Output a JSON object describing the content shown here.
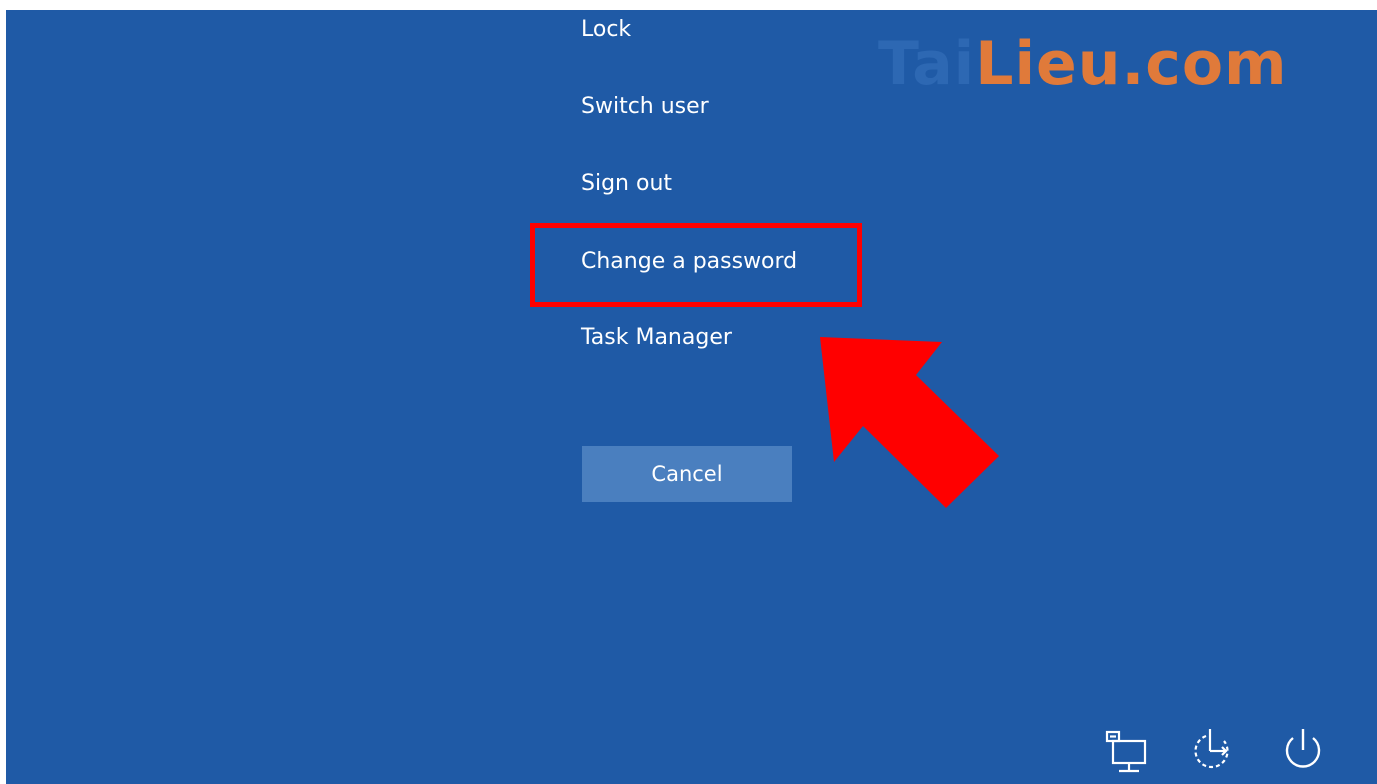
{
  "menu": {
    "items": [
      {
        "label": "Lock"
      },
      {
        "label": "Switch user"
      },
      {
        "label": "Sign out"
      },
      {
        "label": "Change a password"
      },
      {
        "label": "Task Manager"
      }
    ]
  },
  "cancel_label": "Cancel",
  "watermark": {
    "part1": "Tai",
    "part2": "Lieu",
    "part3": ".com"
  },
  "tray": {
    "icons": [
      "network-icon",
      "accessibility-icon",
      "power-icon"
    ]
  },
  "colors": {
    "background": "#1f5aa6",
    "text": "#ffffff",
    "cancel_button": "#4a7fbf",
    "annotation_red": "#ff0000",
    "watermark_orange": "#e07a3a"
  },
  "annotation": {
    "highlighted_item": "Change a password"
  }
}
